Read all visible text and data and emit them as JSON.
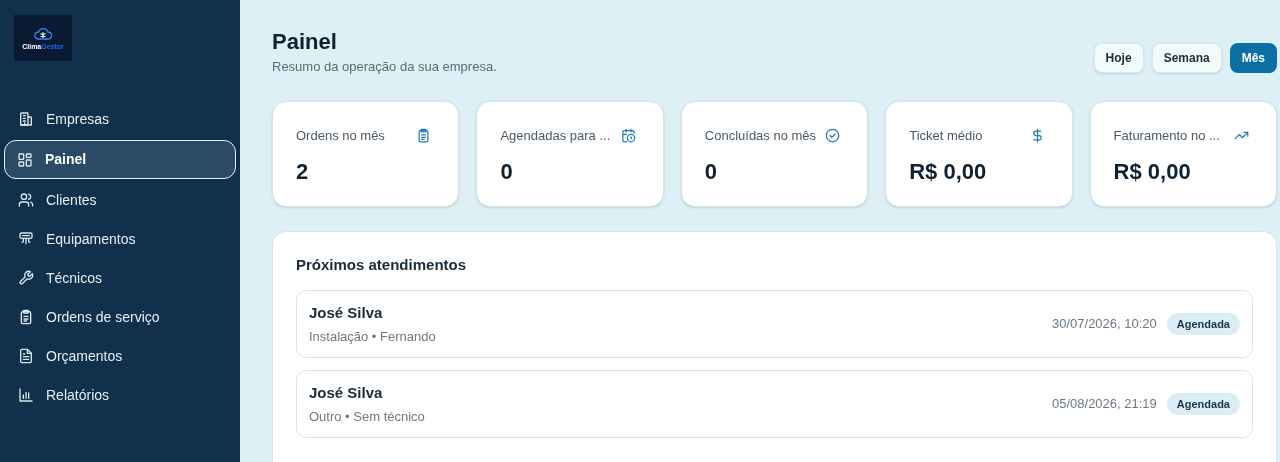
{
  "logo": {
    "part_1": "Clima",
    "part_2": "Gestor"
  },
  "sidebar": {
    "items": [
      {
        "label": "Empresas",
        "kind": "building",
        "selected": false
      },
      {
        "label": "Painel",
        "kind": "grid",
        "selected": true
      },
      {
        "label": "Clientes",
        "kind": "users",
        "selected": false
      },
      {
        "label": "Equipamentos",
        "kind": "aircon",
        "selected": false
      },
      {
        "label": "Técnicos",
        "kind": "wrench",
        "selected": false
      },
      {
        "label": "Ordens de serviço",
        "kind": "clipboard",
        "selected": false
      },
      {
        "label": "Orçamentos",
        "kind": "file",
        "selected": false
      },
      {
        "label": "Relatórios",
        "kind": "chart",
        "selected": false
      }
    ]
  },
  "header": {
    "title": "Painel",
    "subtitle": "Resumo da operação da sua empresa."
  },
  "period_buttons": [
    {
      "label": "Hoje",
      "selected": false
    },
    {
      "label": "Semana",
      "selected": false
    },
    {
      "label": "Mês",
      "selected": true
    }
  ],
  "stats": [
    {
      "label": "Ordens no mês",
      "value": "2",
      "kind": "clipboard"
    },
    {
      "label": "Agendadas para ...",
      "value": "0",
      "kind": "calendar"
    },
    {
      "label": "Concluídas no mês",
      "value": "0",
      "kind": "check"
    },
    {
      "label": "Ticket médio",
      "value": "R$ 0,00",
      "kind": "dollar"
    },
    {
      "label": "Faturamento no ...",
      "value": "R$ 0,00",
      "kind": "trend"
    }
  ],
  "upcoming": {
    "title": "Próximos atendimentos",
    "rows": [
      {
        "client": "José Silva",
        "details": "Instalação • Fernando",
        "datetime": "30/07/2026, 10:20",
        "status": "Agendada"
      },
      {
        "client": "José Silva",
        "details": "Outro • Sem técnico",
        "datetime": "05/08/2026, 21:19",
        "status": "Agendada"
      }
    ]
  }
}
